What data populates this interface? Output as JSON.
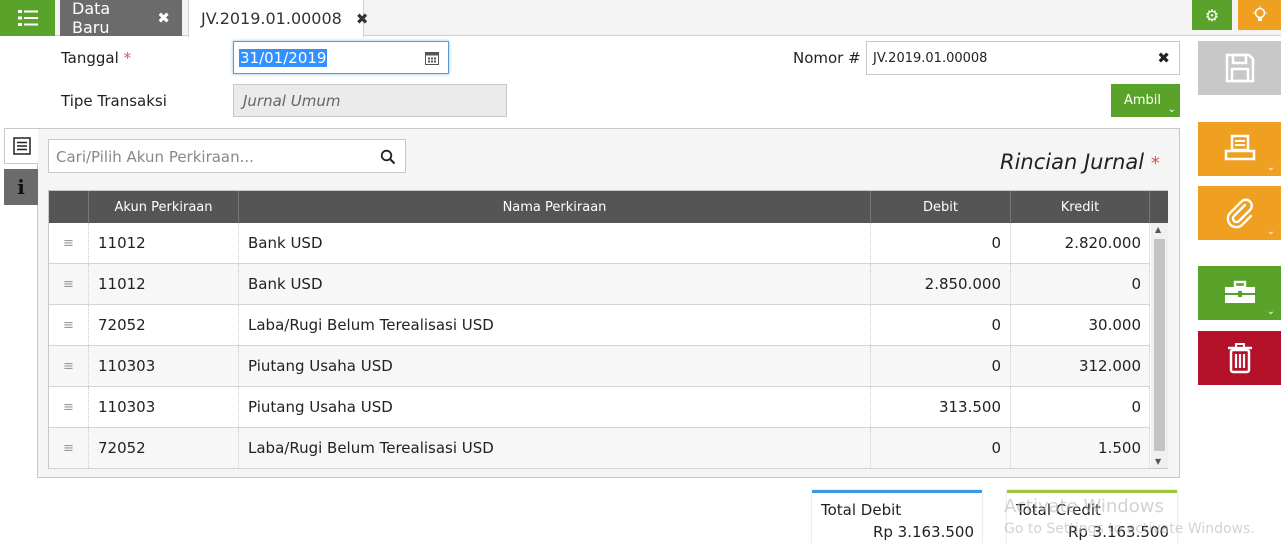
{
  "tabs": {
    "data_baru": "Data Baru",
    "current": "JV.2019.01.00008"
  },
  "form": {
    "tanggal_label": "Tanggal",
    "required_mark": "*",
    "tanggal_value": "31/01/2019",
    "tipe_label": "Tipe Transaksi",
    "tipe_value": "Jurnal Umum",
    "nomor_label": "Nomor #",
    "nomor_value": "JV.2019.01.00008",
    "ambil_label": "Ambil"
  },
  "panel": {
    "search_placeholder": "Cari/Pilih Akun Perkiraan...",
    "title": "Rincian Jurnal"
  },
  "grid": {
    "columns": [
      "Akun Perkiraan",
      "Nama Perkiraan",
      "Debit",
      "Kredit"
    ],
    "rows": [
      {
        "kode": "11012",
        "nama": "Bank USD",
        "debit": "0",
        "kredit": "2.820.000"
      },
      {
        "kode": "11012",
        "nama": "Bank USD",
        "debit": "2.850.000",
        "kredit": "0"
      },
      {
        "kode": "72052",
        "nama": "Laba/Rugi Belum Terealisasi USD",
        "debit": "0",
        "kredit": "30.000"
      },
      {
        "kode": "110303",
        "nama": "Piutang Usaha USD",
        "debit": "0",
        "kredit": "312.000"
      },
      {
        "kode": "110303",
        "nama": "Piutang Usaha USD",
        "debit": "313.500",
        "kredit": "0"
      },
      {
        "kode": "72052",
        "nama": "Laba/Rugi Belum Terealisasi USD",
        "debit": "0",
        "kredit": "1.500"
      }
    ]
  },
  "totals": {
    "debit_label": "Total Debit",
    "debit_value": "Rp 3.163.500",
    "kredit_label": "Total Credit",
    "kredit_value": "Rp 3.163.500"
  },
  "watermark": {
    "line1": "Activate Windows",
    "line2": "Go to Settings to activate Windows."
  },
  "colors": {
    "green": "#5aa32a",
    "orange": "#f0a020",
    "red": "#b3102a",
    "grey": "#c8c8c8",
    "header_dark": "#555555"
  },
  "icons": [
    "list-menu-icon",
    "close-icon",
    "gear-icon",
    "lightbulb-icon",
    "calendar-icon",
    "search-icon",
    "list-view-icon",
    "info-icon",
    "drag-handle-icon",
    "save-icon",
    "print-icon",
    "paperclip-icon",
    "briefcase-icon",
    "trash-icon",
    "chevron-down-icon"
  ]
}
